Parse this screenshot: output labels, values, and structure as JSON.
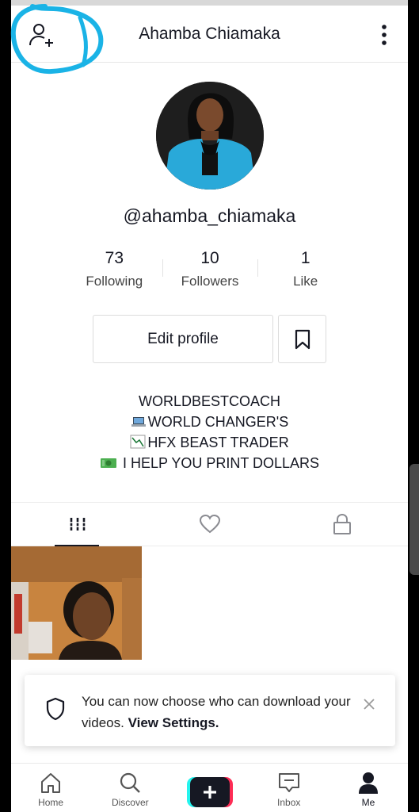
{
  "header": {
    "title": "Ahamba Chiamaka"
  },
  "profile": {
    "username": "@ahamba_chiamaka",
    "stats": [
      {
        "value": "73",
        "label": "Following"
      },
      {
        "value": "10",
        "label": "Followers"
      },
      {
        "value": "1",
        "label": "Like"
      }
    ],
    "edit_label": "Edit profile",
    "bio": {
      "line1": "WORLDBESTCOACH",
      "line2_text": "WORLD CHANGER'S",
      "line3_text": "HFX BEAST TRADER",
      "line4_text": " I HELP YOU PRINT DOLLARS"
    }
  },
  "toast": {
    "text": "You can now choose who can download your videos. ",
    "link": "View Settings."
  },
  "nav": {
    "items": [
      {
        "label": "Home"
      },
      {
        "label": "Discover"
      },
      {
        "label": ""
      },
      {
        "label": "Inbox"
      },
      {
        "label": "Me"
      }
    ]
  },
  "colors": {
    "annotation": "#1ab3e6",
    "create_left": "#25f4ee",
    "create_right": "#fe2c55"
  }
}
